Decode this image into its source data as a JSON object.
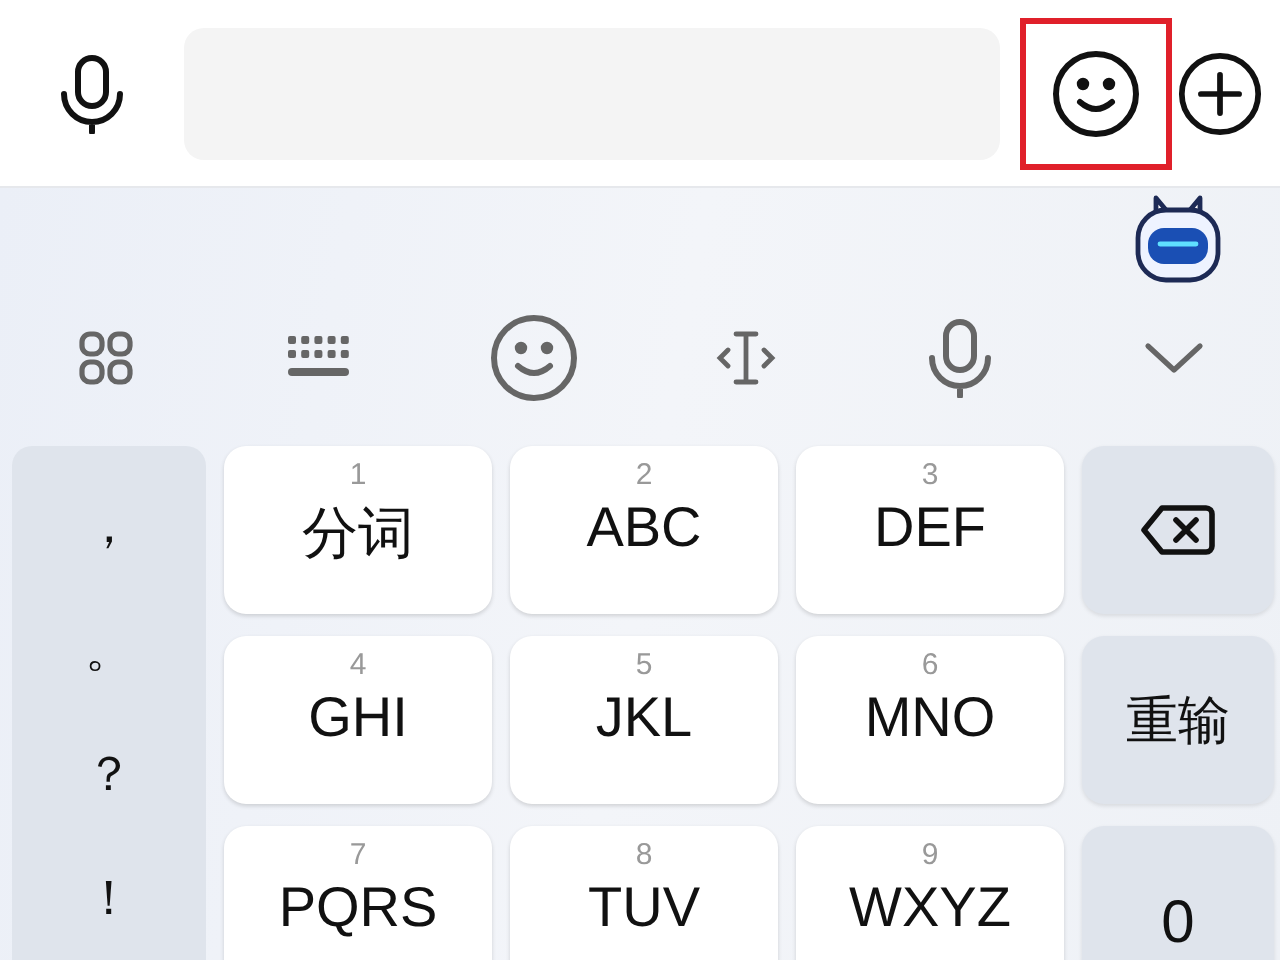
{
  "input_bar": {
    "leading": [
      {
        "kind": "voice",
        "highlighted": false
      }
    ],
    "trailing": [
      {
        "kind": "emoji",
        "highlighted": true
      },
      {
        "kind": "add",
        "highlighted": false
      }
    ]
  },
  "toolbar": [
    {
      "kind": "apps"
    },
    {
      "kind": "keyboard"
    },
    {
      "kind": "emoji"
    },
    {
      "kind": "cursor"
    },
    {
      "kind": "voice"
    },
    {
      "kind": "collapse"
    }
  ],
  "punctuation": [
    "，",
    "。",
    "？",
    "！"
  ],
  "keys": [
    {
      "digit": "1",
      "label": "分词"
    },
    {
      "digit": "2",
      "label": "ABC"
    },
    {
      "digit": "3",
      "label": "DEF"
    },
    {
      "digit": "4",
      "label": "GHI"
    },
    {
      "digit": "5",
      "label": "JKL"
    },
    {
      "digit": "6",
      "label": "MNO"
    },
    {
      "digit": "7",
      "label": "PQRS"
    },
    {
      "digit": "8",
      "label": "TUV"
    },
    {
      "digit": "9",
      "label": "WXYZ"
    }
  ],
  "side_keys": [
    {
      "kind": "backspace"
    },
    {
      "kind": "text",
      "label": "重输"
    },
    {
      "kind": "text",
      "label": "0"
    }
  ]
}
